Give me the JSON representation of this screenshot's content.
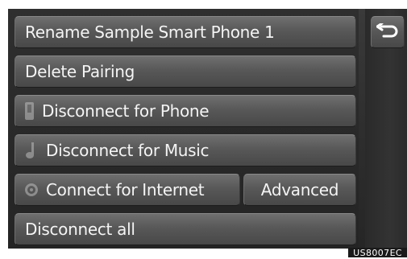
{
  "menu": {
    "rename_label": "Rename Sample Smart Phone 1",
    "delete_label": "Delete Pairing",
    "disconnect_phone_label": "Disconnect for Phone",
    "disconnect_music_label": "Disconnect for Music",
    "connect_internet_label": "Connect for Internet",
    "advanced_label": "Advanced",
    "disconnect_all_label": "Disconnect all"
  },
  "icons": {
    "back": "back-arrow-icon",
    "phone": "phone-icon",
    "music": "music-note-icon",
    "internet": "globe-icon"
  },
  "caption": {
    "code": "US8007EC"
  }
}
